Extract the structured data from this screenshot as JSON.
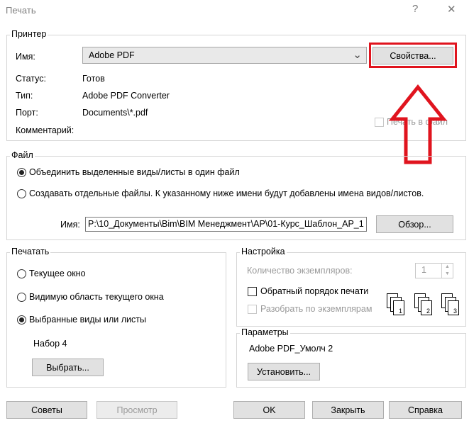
{
  "window": {
    "title": "Печать",
    "help_icon": "?",
    "close_icon": "✕"
  },
  "printer": {
    "legend": "Принтер",
    "name_label": "Имя:",
    "name_value": "Adobe PDF",
    "properties_button": "Свойства...",
    "status_label": "Статус:",
    "status_value": "Готов",
    "type_label": "Тип:",
    "type_value": "Adobe PDF Converter",
    "port_label": "Порт:",
    "port_value": "Documents\\*.pdf",
    "comment_label": "Комментарий:",
    "print_to_file": "Печать в файл"
  },
  "file": {
    "legend": "Файл",
    "option_combine": "Объединить выделенные виды/листы в один файл",
    "option_separate": "Создавать отдельные файлы. К указанному ниже имени будут добавлены имена видов/листов.",
    "name_label": "Имя:",
    "name_value": "P:\\10_Документы\\Bim\\BIM Менеджмент\\AP\\01-Курс_Шаблон_AP_1",
    "browse_button": "Обзор..."
  },
  "print_range": {
    "legend": "Печатать",
    "option_current": "Текущее окно",
    "option_visible": "Видимую область текущего окна",
    "option_selected": "Выбранные виды или листы",
    "set_name": "Набор 4",
    "select_button": "Выбрать..."
  },
  "settings": {
    "legend": "Настройка",
    "copies_label": "Количество экземпляров:",
    "copies_value": "1",
    "reverse_order": "Обратный порядок печати",
    "collate": "Разобрать по экземплярам",
    "collate_icons": [
      "1",
      "2",
      "3"
    ]
  },
  "params": {
    "legend": "Параметры",
    "value": "Adobe PDF_Умолч 2",
    "setup_button": "Установить..."
  },
  "footer": {
    "tips": "Советы",
    "preview": "Просмотр",
    "ok": "OK",
    "close": "Закрыть",
    "help": "Справка"
  },
  "annotation_color": "#e0141e"
}
